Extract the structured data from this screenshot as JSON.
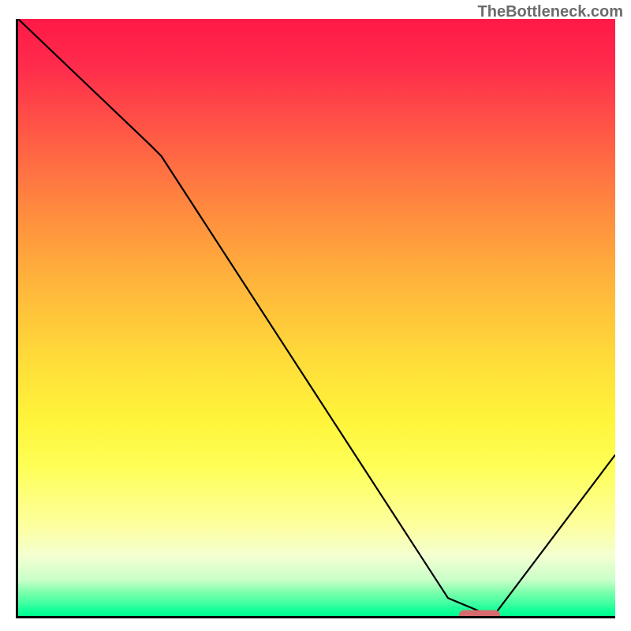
{
  "attribution": "TheBottleneck.com",
  "colors": {
    "curve": "#000000",
    "marker": "#d76a6c",
    "axis": "#000000"
  },
  "chart_data": {
    "type": "line",
    "title": "",
    "xlabel": "",
    "ylabel": "",
    "xlim": [
      0,
      100
    ],
    "ylim": [
      0,
      100
    ],
    "series": [
      {
        "name": "curve",
        "x": [
          0,
          22,
          24,
          72,
          78,
          80,
          100
        ],
        "values": [
          100,
          79,
          77,
          3,
          0.5,
          0.5,
          27
        ]
      }
    ],
    "marker": {
      "x": 77,
      "y": 0.5
    }
  }
}
